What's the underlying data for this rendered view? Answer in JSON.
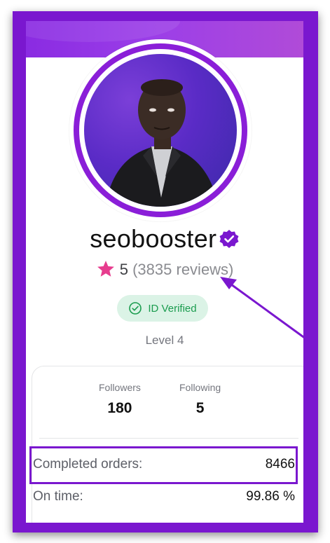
{
  "profile": {
    "username": "seobooster",
    "rating_value": "5",
    "reviews_text": "(3835 reviews)",
    "id_badge": "ID Verified",
    "level": "Level 4"
  },
  "stats": {
    "followers_label": "Followers",
    "followers_value": "180",
    "following_label": "Following",
    "following_value": "5"
  },
  "orders": {
    "completed_label": "Completed orders:",
    "completed_value": "8466",
    "ontime_label": "On time:",
    "ontime_value": "99.86 %"
  },
  "icons": {
    "verified": "verified-badge-icon",
    "star": "star-icon",
    "check": "check-circle-icon"
  },
  "colors": {
    "frame": "#7a17cf",
    "banner": "#8a2be2",
    "star": "#e73c8e",
    "badge_bg": "#dbf3e6",
    "badge_text": "#1a9c4e"
  }
}
